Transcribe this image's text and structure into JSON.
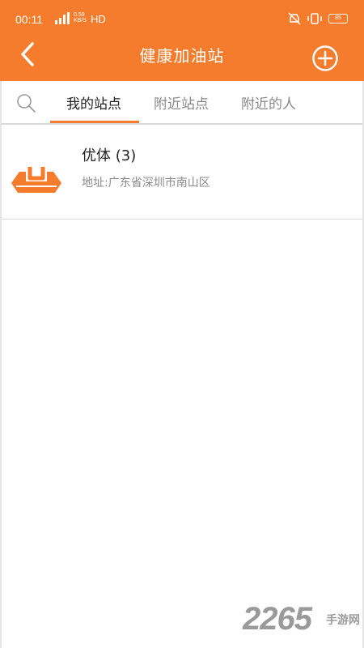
{
  "status_bar": {
    "time": "00:11",
    "speed_value": "0.59",
    "speed_unit": "KB/S",
    "network": "HD",
    "battery": "85"
  },
  "header": {
    "title": "健康加油站",
    "back_icon": "chevron-left-icon",
    "add_icon": "plus-circle-icon"
  },
  "tabs": {
    "search_icon": "search-icon",
    "items": [
      {
        "label": "我的站点",
        "active": true
      },
      {
        "label": "附近站点",
        "active": false
      },
      {
        "label": "附近的人",
        "active": false
      }
    ]
  },
  "stations": [
    {
      "name": "优体 (3)",
      "address": "地址:广东省深圳市南山区"
    }
  ],
  "watermark": {
    "number": "2265",
    "text": "手游网"
  },
  "colors": {
    "accent": "#f47c2c",
    "text": "#222222",
    "muted": "#8a8a8a"
  }
}
